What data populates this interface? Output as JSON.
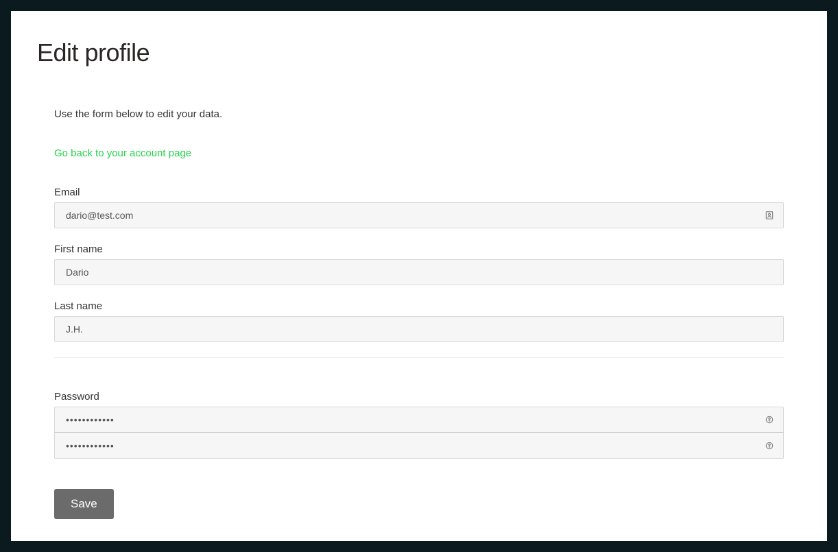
{
  "page": {
    "title": "Edit profile",
    "intro": "Use the form below to edit your data.",
    "back_link": "Go back to your account page"
  },
  "form": {
    "email": {
      "label": "Email",
      "value": "dario@test.com"
    },
    "first_name": {
      "label": "First name",
      "value": "Dario"
    },
    "last_name": {
      "label": "Last name",
      "value": "J.H."
    },
    "password": {
      "label": "Password",
      "value": "••••••••••••",
      "confirm_value": "••••••••••••"
    },
    "save_label": "Save"
  }
}
